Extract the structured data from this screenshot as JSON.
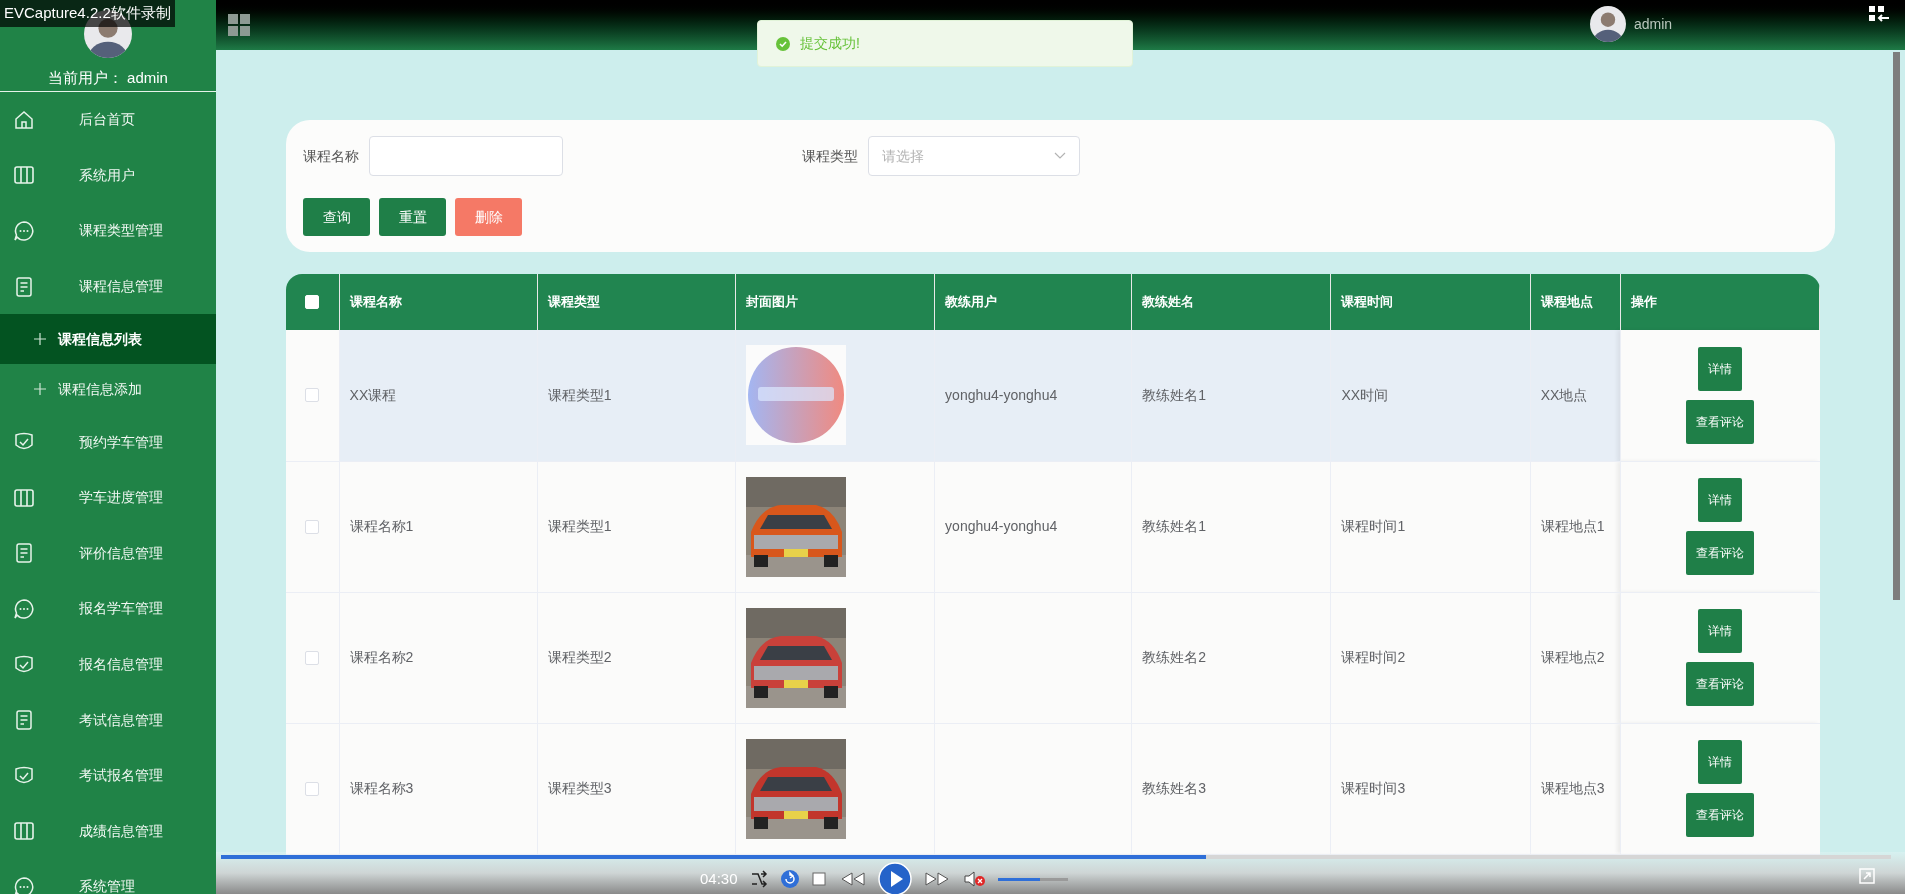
{
  "recorder": {
    "title": "EVCapture4.2.2软件录制",
    "time": "04:30",
    "seek": {
      "level": 0.59
    },
    "volume": {
      "level": 0.6
    }
  },
  "sidebar": {
    "user_label": "当前用户：",
    "username": "admin",
    "items": [
      {
        "label": "后台首页",
        "kind": "home",
        "selected": false
      },
      {
        "label": "系统用户",
        "kind": "columns",
        "selected": false
      },
      {
        "label": "课程类型管理",
        "kind": "chat",
        "selected": false
      },
      {
        "label": "课程信息管理",
        "kind": "doc",
        "selected": false,
        "children": [
          {
            "label": "课程信息列表",
            "selected": true
          },
          {
            "label": "课程信息添加",
            "selected": false
          }
        ]
      },
      {
        "label": "预约学车管理",
        "kind": "shield",
        "selected": false
      },
      {
        "label": "学车进度管理",
        "kind": "columns",
        "selected": false
      },
      {
        "label": "评价信息管理",
        "kind": "doc",
        "selected": false
      },
      {
        "label": "报名学车管理",
        "kind": "chat",
        "selected": false
      },
      {
        "label": "报名信息管理",
        "kind": "shield",
        "selected": false
      },
      {
        "label": "考试信息管理",
        "kind": "doc",
        "selected": false
      },
      {
        "label": "考试报名管理",
        "kind": "shield",
        "selected": false
      },
      {
        "label": "成绩信息管理",
        "kind": "columns",
        "selected": false
      },
      {
        "label": "系统管理",
        "kind": "chat",
        "selected": false
      }
    ]
  },
  "header": {
    "username": "admin"
  },
  "toast": {
    "text": "提交成功!"
  },
  "search": {
    "fields": [
      {
        "label": "课程名称",
        "kind": "text"
      },
      {
        "label": "课程类型",
        "kind": "select",
        "placeholder": "请选择"
      }
    ],
    "buttons": [
      {
        "label": "查询",
        "kind": "primary"
      },
      {
        "label": "重置",
        "kind": "primary"
      },
      {
        "label": "删除",
        "kind": "danger"
      }
    ]
  },
  "table": {
    "select_all": {
      "checked": false
    },
    "columns": [
      "课程名称",
      "课程类型",
      "封面图片",
      "教练用户",
      "教练姓名",
      "课程时间",
      "课程地点",
      "操作"
    ],
    "rows": [
      {
        "selected": true,
        "checked": false,
        "cells": [
          "XX课程",
          "课程类型1",
          {
            "kind": "picture"
          },
          "yonghu4-yonghu4",
          "教练姓名1",
          "XX时间",
          "XX地点"
        ],
        "actions": [
          "详情",
          "查看评论"
        ]
      },
      {
        "selected": false,
        "checked": false,
        "cells": [
          "课程名称1",
          "课程类型1",
          {
            "kind": "picture"
          },
          "yonghu4-yonghu4",
          "教练姓名1",
          "课程时间1",
          "课程地点1"
        ],
        "actions": [
          "详情",
          "查看评论"
        ]
      },
      {
        "selected": false,
        "checked": false,
        "cells": [
          "课程名称2",
          "课程类型2",
          {
            "kind": "picture"
          },
          "",
          "教练姓名2",
          "课程时间2",
          "课程地点2"
        ],
        "actions": [
          "详情",
          "查看评论"
        ]
      },
      {
        "selected": false,
        "checked": false,
        "cells": [
          "课程名称3",
          "课程类型3",
          {
            "kind": "picture"
          },
          "",
          "教练姓名3",
          "课程时间3",
          "课程地点3"
        ],
        "actions": [
          "详情",
          "查看评论"
        ]
      }
    ]
  }
}
